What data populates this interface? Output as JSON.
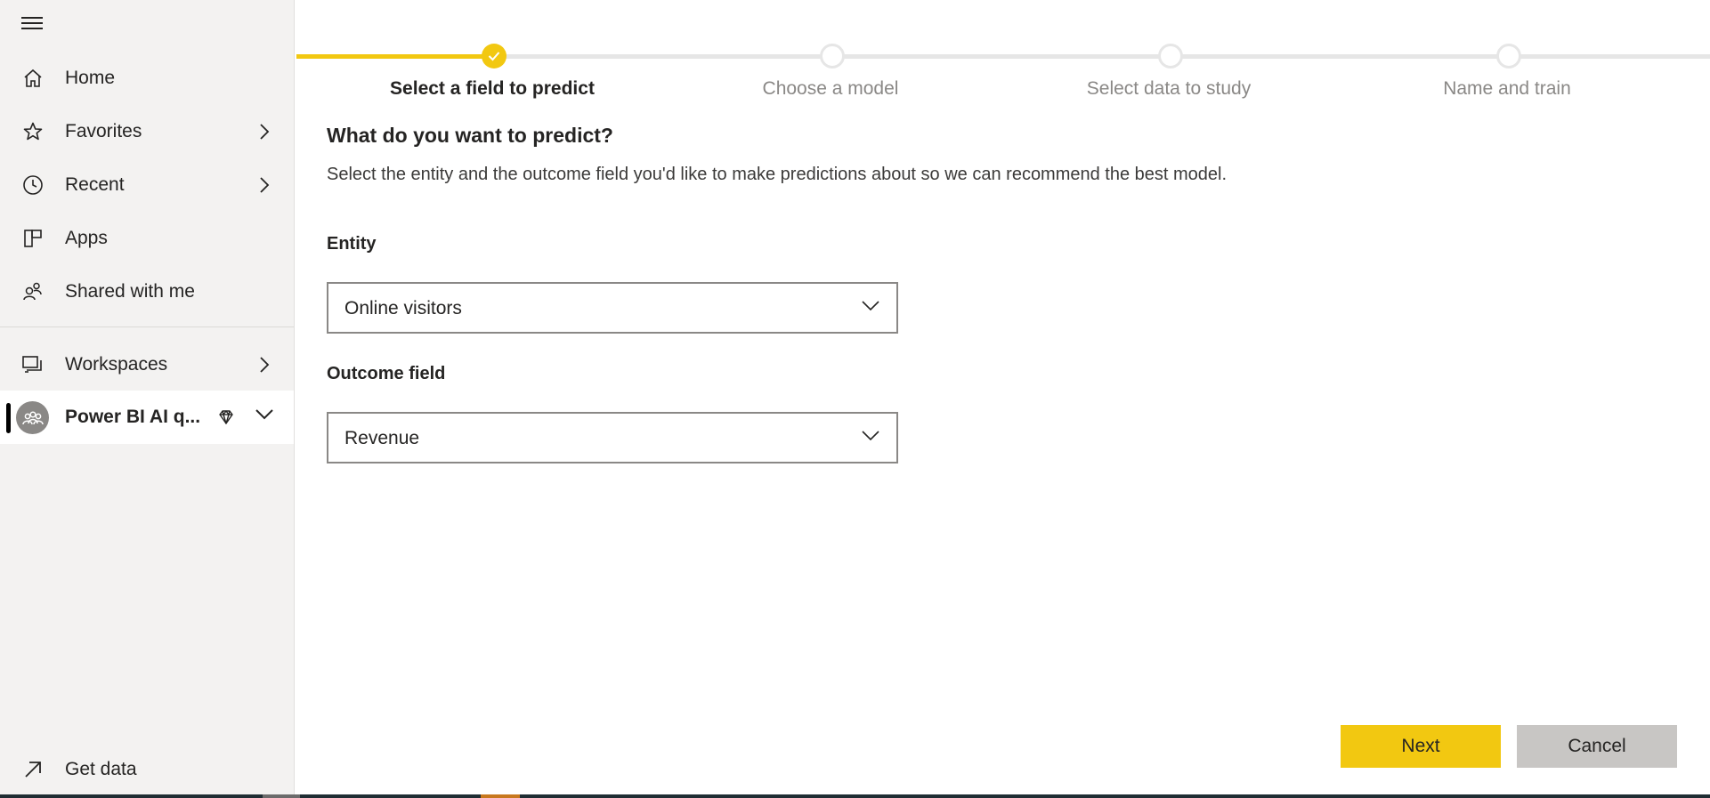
{
  "sidebar": {
    "items": [
      {
        "label": "Home"
      },
      {
        "label": "Favorites"
      },
      {
        "label": "Recent"
      },
      {
        "label": "Apps"
      },
      {
        "label": "Shared with me"
      },
      {
        "label": "Workspaces"
      },
      {
        "label": "Power BI AI q..."
      }
    ],
    "get_data_label": "Get data",
    "icons": {
      "menu": "hamburger-icon",
      "home": "home-icon",
      "favorites": "star-icon",
      "recent": "clock-icon",
      "apps": "apps-icon",
      "shared": "people-icon",
      "workspaces": "workspaces-icon",
      "workspace_avatar": "group-icon",
      "premium": "diamond-icon",
      "get_data": "arrow-up-right-icon"
    }
  },
  "stepper": {
    "steps": [
      {
        "label": "Select a field to predict",
        "status": "completed"
      },
      {
        "label": "Choose a model",
        "status": "pending"
      },
      {
        "label": "Select data to study",
        "status": "pending"
      },
      {
        "label": "Name and train",
        "status": "pending"
      }
    ]
  },
  "main": {
    "heading": "What do you want to predict?",
    "description": "Select the entity and the outcome field you'd like to make predictions about so we can recommend the best model.",
    "entity": {
      "label": "Entity",
      "value": "Online visitors"
    },
    "outcome": {
      "label": "Outcome field",
      "value": "Revenue"
    }
  },
  "actions": {
    "next_label": "Next",
    "cancel_label": "Cancel"
  },
  "colors": {
    "accent": "#f2c811",
    "sidebar_bg": "#f3f2f1",
    "cancel_bg": "#c8c6c4"
  }
}
